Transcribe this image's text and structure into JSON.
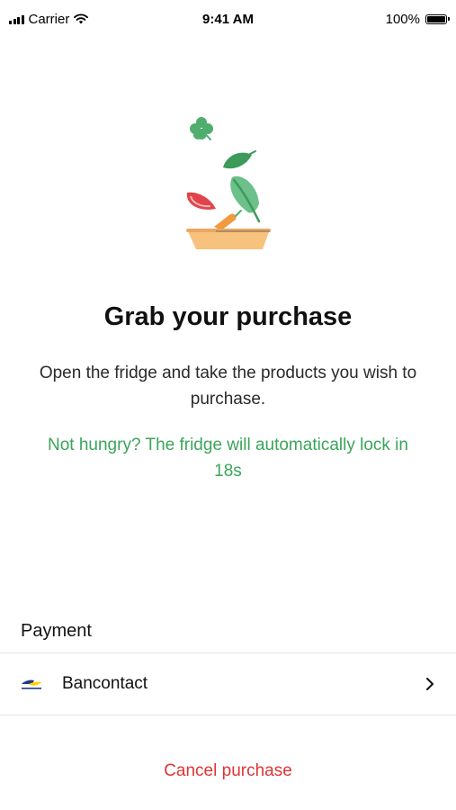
{
  "status_bar": {
    "carrier": "Carrier",
    "time": "9:41 AM",
    "battery": "100%"
  },
  "illustration": {
    "icon": "salad-bowl-icon",
    "colors": {
      "clover": "#4fae6e",
      "leaf_dark": "#3c9a5a",
      "leaf_light": "#6cc08a",
      "tomato": "#e0444a",
      "carrot": "#f19a3e",
      "bowl": "#f7c27e"
    }
  },
  "main": {
    "title": "Grab your purchase",
    "subtitle": "Open the fridge and take the products you wish to purchase.",
    "countdown": "Not hungry? The fridge will automatically lock in 18s"
  },
  "payment": {
    "heading": "Payment",
    "method": "Bancontact",
    "method_icon": "bancontact-logo",
    "chevron_icon": "chevron-right-icon"
  },
  "actions": {
    "cancel_label": "Cancel purchase"
  },
  "colors": {
    "accent_green": "#3aa55a",
    "cancel_red": "#e03434"
  }
}
